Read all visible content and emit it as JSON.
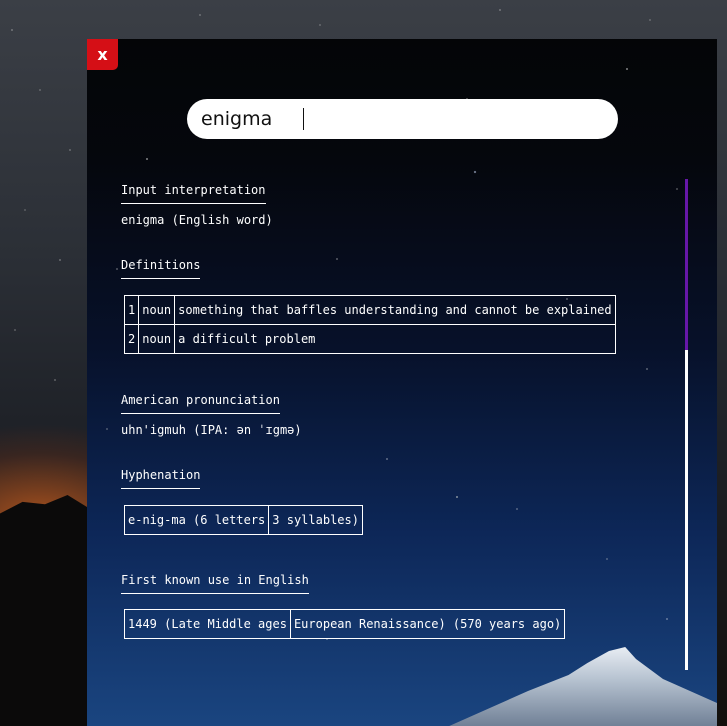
{
  "app": {
    "close_label": "x",
    "accent_color": "#d50f16",
    "scroll_thumb_color": "#6617a8"
  },
  "search": {
    "value": "enigma"
  },
  "sections": {
    "input_interpretation": {
      "title": "Input interpretation",
      "text": "enigma (English word)"
    },
    "definitions": {
      "title": "Definitions",
      "rows": [
        {
          "num": "1",
          "pos": "noun",
          "text": "something that baffles understanding and cannot be explained"
        },
        {
          "num": "2",
          "pos": "noun",
          "text": "a difficult problem"
        }
      ]
    },
    "pronunciation": {
      "title": "American pronunciation",
      "text": "uhn'igmuh (IPA: ən ˈɪgmə)"
    },
    "hyphenation": {
      "title": "Hyphenation",
      "cells": [
        "e-nig-ma (6 letters",
        "3 syllables)"
      ]
    },
    "first_use": {
      "title": "First known use in English",
      "cells": [
        "1449 (Late Middle ages",
        "European Renaissance) (570 years ago)"
      ]
    }
  }
}
